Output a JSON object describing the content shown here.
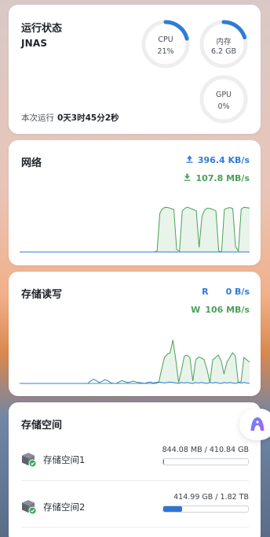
{
  "status": {
    "title": "运行状态",
    "host": "JNAS",
    "uptime_label": "本次运行",
    "uptime_value": "0天3时45分2秒",
    "gauges": [
      {
        "label": "CPU",
        "value": "21%",
        "fraction": 0.21
      },
      {
        "label": "内存",
        "value": "6.2 GB",
        "fraction": 0.2
      },
      {
        "label": "GPU",
        "value": "0%",
        "fraction": 0
      }
    ]
  },
  "network": {
    "title": "网络",
    "upload": "396.4 KB/s",
    "download": "107.8 MB/s",
    "upload_icon": "upload-arrow-icon",
    "download_icon": "download-arrow-icon"
  },
  "disk_io": {
    "title": "存储读写",
    "read_label": "R",
    "read_value": "0 B/s",
    "write_label": "W",
    "write_value": "106 MB/s"
  },
  "storage": {
    "title": "存储空间",
    "volumes": [
      {
        "name": "存储空间1",
        "size": "844.08 MB / 410.84 GB",
        "fraction": 0.002
      },
      {
        "name": "存储空间2",
        "size": "414.99 GB / 1.82 TB",
        "fraction": 0.22
      }
    ]
  },
  "colors": {
    "accent_blue": "#2f7bd8",
    "accent_green": "#4aa05a",
    "gauge_track": "#eeeeee"
  },
  "chart_data": [
    {
      "type": "area",
      "title": "网络",
      "series": [
        {
          "values": [
            0,
            0,
            0,
            0,
            0,
            0,
            0,
            0,
            0,
            0,
            0,
            0,
            0,
            0,
            0,
            0,
            0,
            0,
            0,
            0,
            0,
            0,
            0,
            0,
            0,
            0,
            0,
            0,
            0,
            0,
            0,
            0,
            0,
            0,
            0,
            0,
            0,
            0,
            0,
            0,
            0,
            0,
            0,
            0,
            0,
            0,
            0,
            0,
            0,
            0.02,
            0.85,
            0.95,
            0.98,
            0.97,
            0.95,
            0.93,
            0.05,
            0.02,
            0.9,
            0.96,
            0.98,
            0.95,
            0.93,
            0.9,
            0.1,
            0.78,
            0.92,
            0.96,
            0.95,
            0.93,
            0.9,
            0.02,
            0.0,
            0.93,
            0.96,
            0.97,
            0.95,
            0.12,
            0.02,
            0.94,
            0.98,
            0.97,
            0.96
          ]
        },
        {
          "values": [
            0,
            0,
            0,
            0,
            0,
            0,
            0,
            0,
            0,
            0,
            0,
            0,
            0,
            0,
            0,
            0,
            0,
            0,
            0,
            0,
            0,
            0,
            0,
            0,
            0,
            0,
            0,
            0,
            0,
            0,
            0,
            0,
            0,
            0,
            0,
            0,
            0,
            0,
            0,
            0,
            0,
            0,
            0,
            0,
            0,
            0,
            0,
            0,
            0,
            0,
            0,
            0,
            0,
            0,
            0,
            0,
            0,
            0,
            0,
            0,
            0,
            0,
            0,
            0,
            0,
            0,
            0,
            0,
            0,
            0,
            0,
            0,
            0,
            0,
            0,
            0,
            0,
            0,
            0,
            0,
            0,
            0,
            0
          ]
        }
      ]
    },
    {
      "type": "area",
      "title": "存储读写",
      "series": [
        {
          "values": [
            0,
            0,
            0,
            0,
            0,
            0,
            0,
            0,
            0,
            0,
            0,
            0,
            0,
            0,
            0,
            0,
            0,
            0,
            0,
            0,
            0,
            0,
            0,
            0,
            0,
            0,
            0,
            0,
            0,
            0,
            0,
            0,
            0,
            0,
            0,
            0,
            0,
            0,
            0,
            0,
            0,
            0,
            0,
            0,
            0,
            0,
            0,
            0,
            0,
            0.02,
            0.3,
            0.55,
            0.62,
            0.65,
            0.92,
            0.5,
            0.02,
            0.28,
            0.58,
            0.6,
            0.55,
            0.05,
            0.5,
            0.56,
            0.54,
            0.5,
            0.3,
            0.02,
            0.5,
            0.55,
            0.6,
            0.48,
            0.2,
            0.45,
            0.55,
            0.65,
            0.58,
            0.02,
            0.04,
            0.55,
            0.5,
            0.45
          ]
        },
        {
          "values": [
            0,
            0,
            0,
            0,
            0,
            0,
            0,
            0,
            0,
            0,
            0,
            0,
            0,
            0,
            0,
            0,
            0,
            0,
            0,
            0,
            0,
            0,
            0,
            0,
            0,
            0.05,
            0.09,
            0.06,
            0.02,
            0.04,
            0.08,
            0.06,
            0.02,
            0,
            0,
            0.03,
            0.06,
            0.04,
            0.02,
            0.03,
            0.05,
            0.03,
            0.02,
            0.01,
            0,
            0.02,
            0.03,
            0.01,
            0.02,
            0.03,
            0.02,
            0.01,
            0.02,
            0.03,
            0.02,
            0.01,
            0,
            0.02,
            0.01,
            0.02,
            0.01,
            0,
            0.02,
            0.01,
            0.02,
            0.01,
            0,
            0.02,
            0.01,
            0.02,
            0.01,
            0,
            0.02,
            0.01,
            0.02,
            0.01,
            0,
            0.02,
            0.01,
            0.02,
            0.01,
            0
          ]
        }
      ]
    }
  ]
}
